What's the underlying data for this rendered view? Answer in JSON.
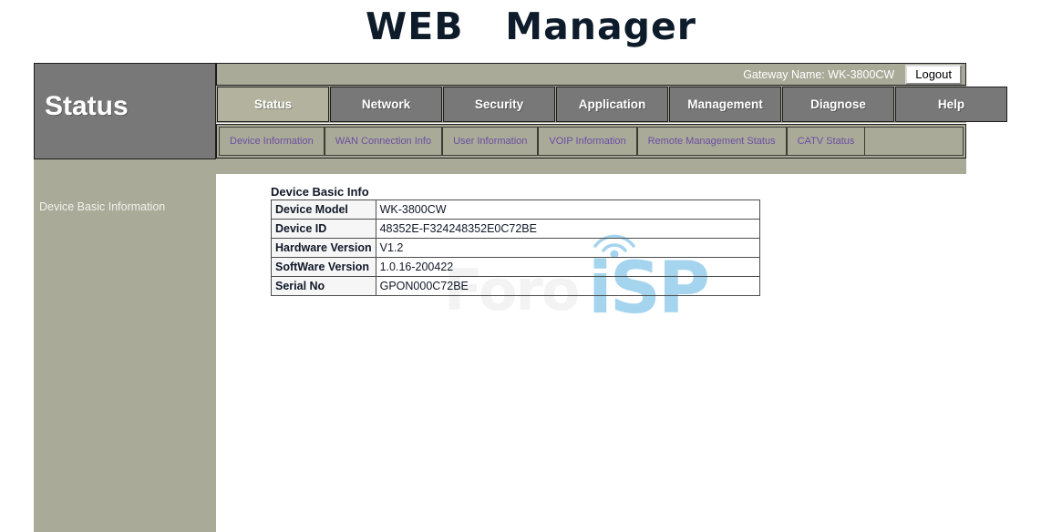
{
  "app": {
    "title": "WEB   Manager"
  },
  "header": {
    "gateway_label": "Gateway Name: WK-3800CW",
    "logout_label": "Logout"
  },
  "sidebar": {
    "section_title": "Status",
    "items": [
      {
        "label": "Device Basic Information"
      }
    ]
  },
  "tabs": [
    {
      "label": "Status",
      "active": true
    },
    {
      "label": "Network",
      "active": false
    },
    {
      "label": "Security",
      "active": false
    },
    {
      "label": "Application",
      "active": false
    },
    {
      "label": "Management",
      "active": false
    },
    {
      "label": "Diagnose",
      "active": false
    },
    {
      "label": "Help",
      "active": false
    }
  ],
  "subnav": [
    {
      "label": "Device Information"
    },
    {
      "label": "WAN Connection Info"
    },
    {
      "label": "User Information"
    },
    {
      "label": "VOIP Information"
    },
    {
      "label": "Remote Management Status"
    },
    {
      "label": "CATV Status"
    }
  ],
  "main": {
    "section_heading": "Device Basic Info",
    "table": {
      "rows": [
        {
          "label": "Device Model",
          "value": "WK-3800CW"
        },
        {
          "label": "Device ID",
          "value": "48352E-F324248352E0C72BE"
        },
        {
          "label": "Hardware Version",
          "value": "V1.2"
        },
        {
          "label": "SoftWare Version",
          "value": "1.0.16-200422"
        },
        {
          "label": "Serial No",
          "value": "GPON000C72BE"
        }
      ]
    }
  },
  "watermark": {
    "text_left": "Foro",
    "text_right": "iSP",
    "icon": "wifi-arc-icon"
  },
  "colors": {
    "khaki": "#aaaa99",
    "tab_gray": "#787878",
    "tab_active": "#b2b29f",
    "link_purple": "#6a4fa3",
    "watermark_blue": "#a5d4ef",
    "title_navy": "#0d1b2a"
  }
}
